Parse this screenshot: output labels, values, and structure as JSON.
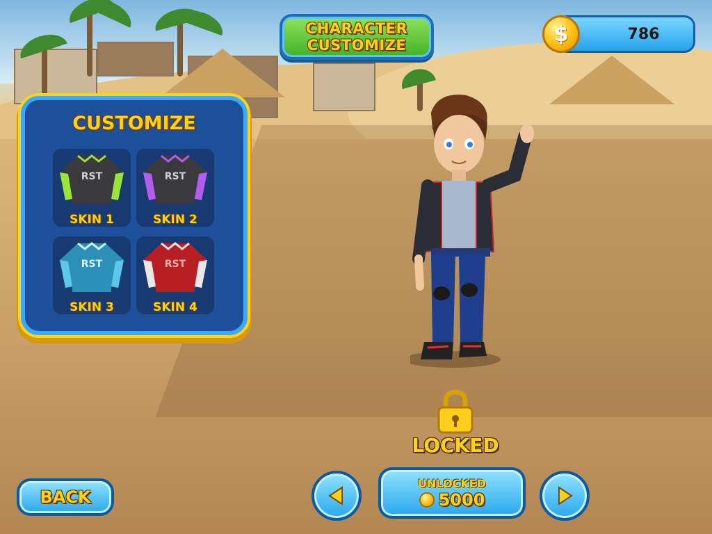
{
  "header": {
    "title_line1": "CHARACTER",
    "title_line2": "CUSTOMIZE"
  },
  "currency": {
    "coins": "786",
    "icon": "coin-icon",
    "symbol": "$"
  },
  "customize_panel": {
    "title": "CUSTOMIZE",
    "skins": [
      {
        "label": "SKIN 1",
        "accent": "#9be23a",
        "icon": "jacket-icon"
      },
      {
        "label": "SKIN 2",
        "accent": "#b35cf0",
        "icon": "jacket-icon"
      },
      {
        "label": "SKIN 3",
        "accent": "#5cc7e8",
        "icon": "jacket-icon"
      },
      {
        "label": "SKIN 4",
        "accent": "#d8282c",
        "icon": "jacket-icon"
      }
    ]
  },
  "status": {
    "state": "LOCKED",
    "icon": "padlock-icon"
  },
  "unlock": {
    "label": "UNLOCKED",
    "price": "5000"
  },
  "nav": {
    "back_label": "BACK",
    "prev_icon": "arrow-left-icon",
    "next_icon": "arrow-right-icon"
  },
  "colors": {
    "accent_yellow": "#ffd21a",
    "button_blue": "#2aa7ec",
    "panel_blue": "#1e4f9a",
    "title_green": "#43b02a"
  }
}
